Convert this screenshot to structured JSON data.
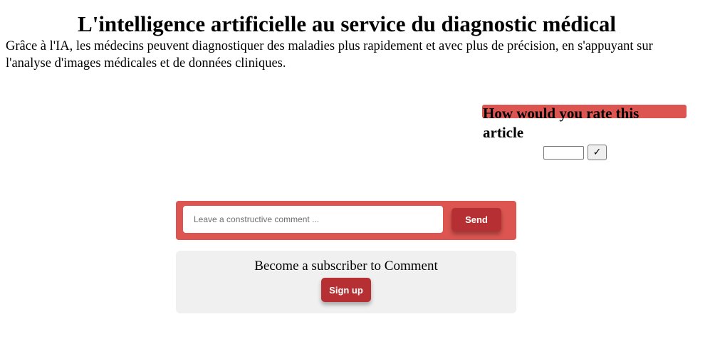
{
  "article": {
    "title": "L'intelligence artificielle au service du diagnostic médical",
    "intro": "Grâce à l'IA, les médecins peuvent diagnostiquer des maladies plus rapidement et avec plus de précision, en s'appuyant sur l'analyse d'images médicales et de données cliniques."
  },
  "rating": {
    "title": "How would you rate this article",
    "input_value": "",
    "submit_label": "✓"
  },
  "comment": {
    "placeholder": "Leave a constructive comment ...",
    "value": "",
    "send_label": "Send"
  },
  "subscribe": {
    "text": "Become a subscriber to Comment",
    "signup_label": "Sign up"
  },
  "colors": {
    "accent_red": "#dc5550",
    "button_red": "#b52f33",
    "panel_gray": "#f0f0f0"
  }
}
